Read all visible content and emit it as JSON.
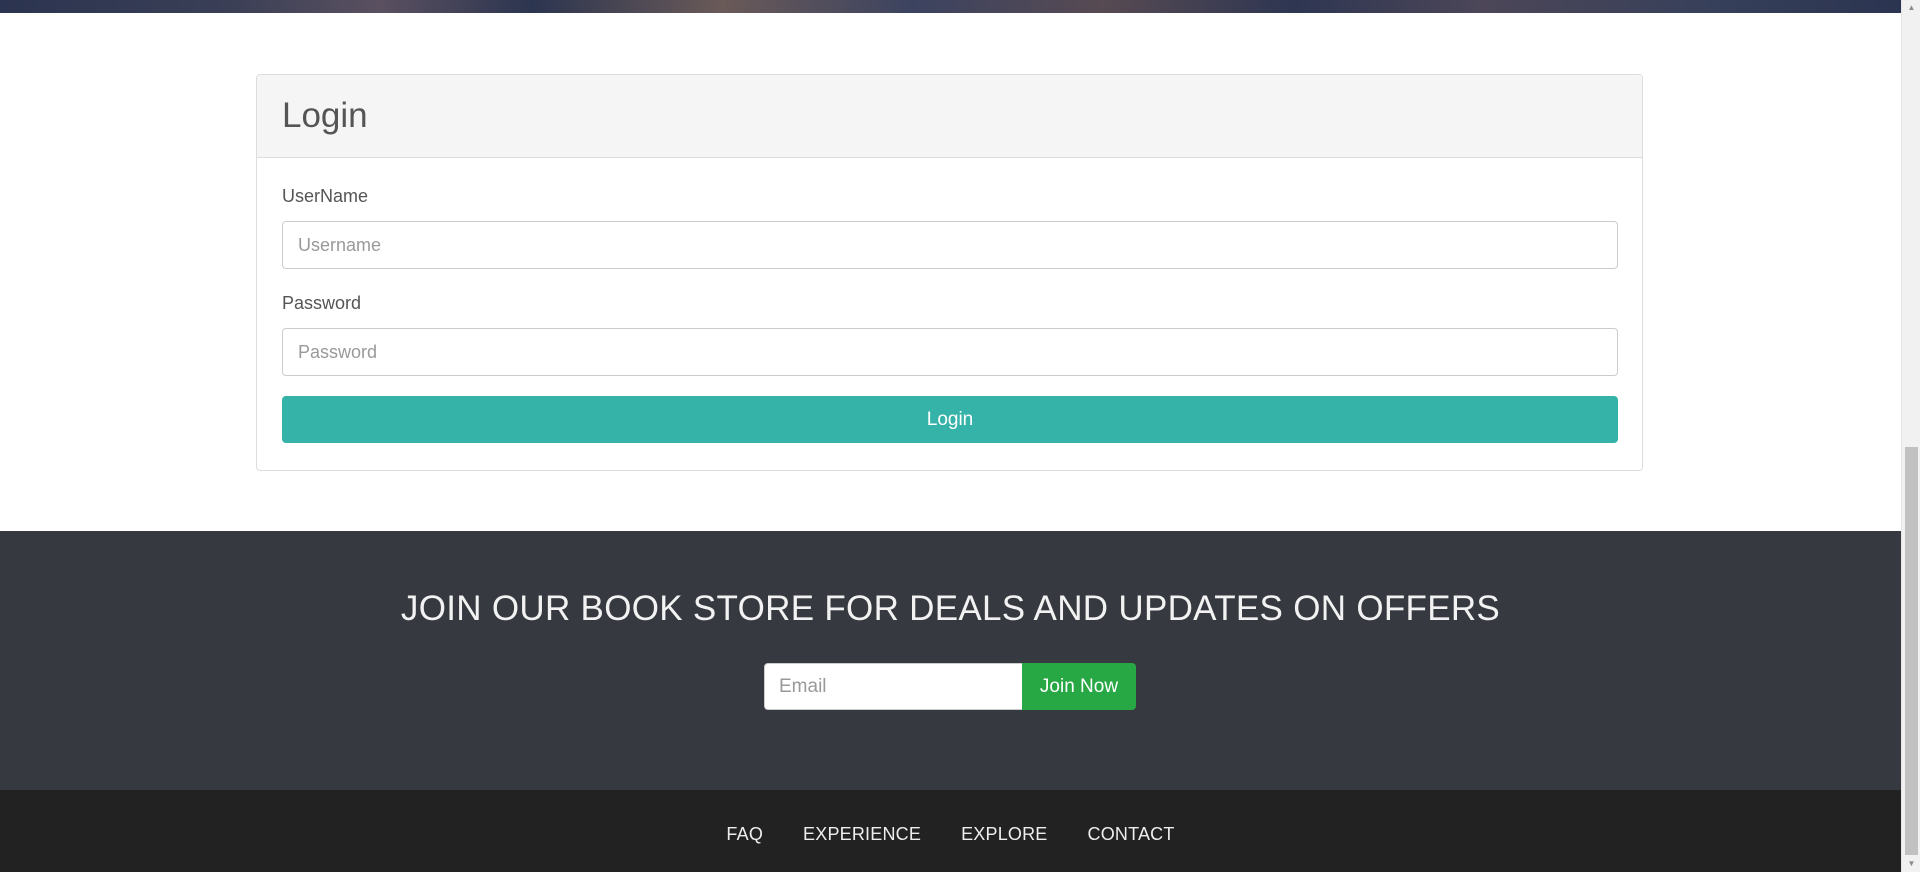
{
  "login": {
    "title": "Login",
    "username_label": "UserName",
    "username_placeholder": "Username",
    "password_label": "Password",
    "password_placeholder": "Password",
    "submit_label": "Login"
  },
  "newsletter": {
    "heading": "JOIN OUR BOOK STORE FOR DEALS AND UPDATES ON OFFERS",
    "email_placeholder": "Email",
    "join_label": "Join Now"
  },
  "footer": {
    "links": [
      "FAQ",
      "EXPERIENCE",
      "EXPLORE",
      "CONTACT"
    ]
  },
  "colors": {
    "login_button": "#36b3a8",
    "join_button": "#28a745",
    "newsletter_bg": "#363a40",
    "footer_bg": "#222222"
  },
  "icons": {
    "scroll_up": "chevron-up-icon",
    "scroll_down": "chevron-down-icon"
  }
}
